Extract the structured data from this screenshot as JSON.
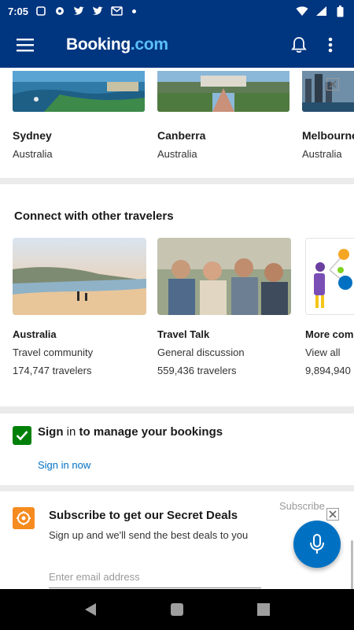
{
  "status_bar": {
    "time": "7:05",
    "icons": [
      "notification-icon",
      "settings-icon",
      "twitter-icon",
      "twitter-icon",
      "gmail-icon"
    ],
    "right_icons": [
      "wifi-icon",
      "signal-icon",
      "battery-icon"
    ]
  },
  "app_bar": {
    "logo_main": "Booking",
    "logo_suffix": ".com",
    "icons": [
      "menu-icon",
      "bell-icon",
      "more-vert-icon"
    ]
  },
  "destinations": [
    {
      "name": "Sydney",
      "country": "Australia"
    },
    {
      "name": "Canberra",
      "country": "Australia"
    },
    {
      "name": "Melbourne",
      "country": "Australia"
    }
  ],
  "community_section": {
    "title": "Connect with other travelers",
    "cards": [
      {
        "name": "Australia",
        "subtitle": "Travel community",
        "count": "174,747 travelers"
      },
      {
        "name": "Travel Talk",
        "subtitle": "General discussion",
        "count": "559,436 travelers"
      },
      {
        "name": "More communities",
        "subtitle": "View all",
        "count": "9,894,940"
      }
    ]
  },
  "signin_panel": {
    "title_parts": [
      "Sign",
      "in",
      "to",
      "manage",
      "your",
      "bookings"
    ],
    "link": "Sign in now"
  },
  "subscribe_panel": {
    "title": "Subscribe to get our Secret Deals",
    "description": "Sign up and we'll send the best deals to you",
    "input_placeholder": "Enter email address",
    "input_value": "",
    "button_label": "Subscribe"
  },
  "colors": {
    "brand_blue": "#003580",
    "link_blue": "#0071c2",
    "accent_green": "#008009",
    "accent_orange": "#f68b1f",
    "logo_dot": "#5bc0f8"
  },
  "nav_bar": {
    "icons": [
      "back-icon",
      "home-icon",
      "recents-icon"
    ]
  }
}
